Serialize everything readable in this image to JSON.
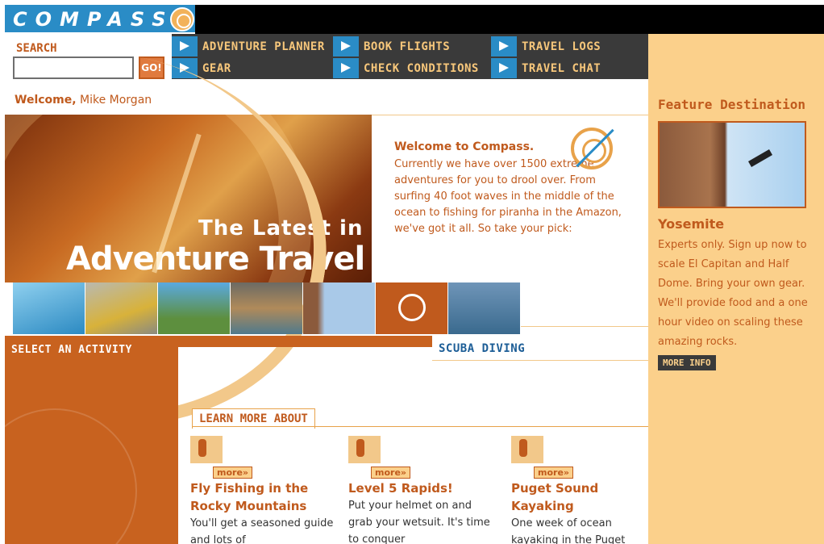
{
  "logo": {
    "text": "COMPASS"
  },
  "nav": {
    "items": [
      {
        "label": "ADVENTURE PLANNER"
      },
      {
        "label": "BOOK FLIGHTS"
      },
      {
        "label": "TRAVEL LOGS"
      },
      {
        "label": "GEAR"
      },
      {
        "label": "CHECK CONDITIONS"
      },
      {
        "label": "TRAVEL CHAT"
      }
    ]
  },
  "search": {
    "label": "SEARCH",
    "value": "",
    "button_label": "GO!"
  },
  "welcome": {
    "prefix": "Welcome,",
    "user": "Mike Morgan"
  },
  "hero": {
    "line1": "The Latest in",
    "line2": "Adventure Travel"
  },
  "intro": {
    "title": "Welcome to Compass.",
    "body": "Currently we have over 1500 extreme adventures for you to drool over. From surfing 40 foot waves in the middle of the ocean to fishing for piranha in the Amazon, we've got it all. So take your pick:"
  },
  "activities": {
    "select_label": "SELECT AN ACTIVITY",
    "current_label": "SCUBA DIVING",
    "items": [
      {
        "icon": "surfing-photo",
        "color": "#3f9fd0"
      },
      {
        "icon": "kayak-photo",
        "color": "#d8b23a"
      },
      {
        "icon": "biking-photo",
        "color": "#5d8f3e"
      },
      {
        "icon": "rafting-photo",
        "color": "#7a6a48"
      },
      {
        "icon": "climbing-photo",
        "color": "#a9c9e8"
      },
      {
        "icon": "compass-activity",
        "color": "#c05a1d"
      },
      {
        "icon": "fishing-photo",
        "color": "#4e7fa8"
      }
    ]
  },
  "learn": {
    "title": "LEARN MORE ABOUT",
    "cards": [
      {
        "more_label": "more»",
        "title": "Fly Fishing in the Rocky Mountains",
        "body": "You'll get a seasoned guide and lots of"
      },
      {
        "more_label": "more»",
        "title": "Level 5 Rapids!",
        "body": "Put your helmet on and grab your wetsuit. It's time to conquer"
      },
      {
        "more_label": "more»",
        "title": "Puget Sound Kayaking",
        "body": "One week of ocean kayaking in the Puget"
      }
    ]
  },
  "feature": {
    "heading": "Feature Destination",
    "name": "Yosemite",
    "body": "Experts only. Sign up now to scale El Capitan and Half Dome. Bring your own  gear. We'll provide food and a one hour video on scaling these amazing rocks.",
    "button_label": "MORE INFO"
  },
  "colors": {
    "accent": "#c05a1d",
    "brand_blue": "#2a8cc6",
    "feature_bg": "#fbd08b",
    "nav_bg": "#3a3a3a"
  }
}
